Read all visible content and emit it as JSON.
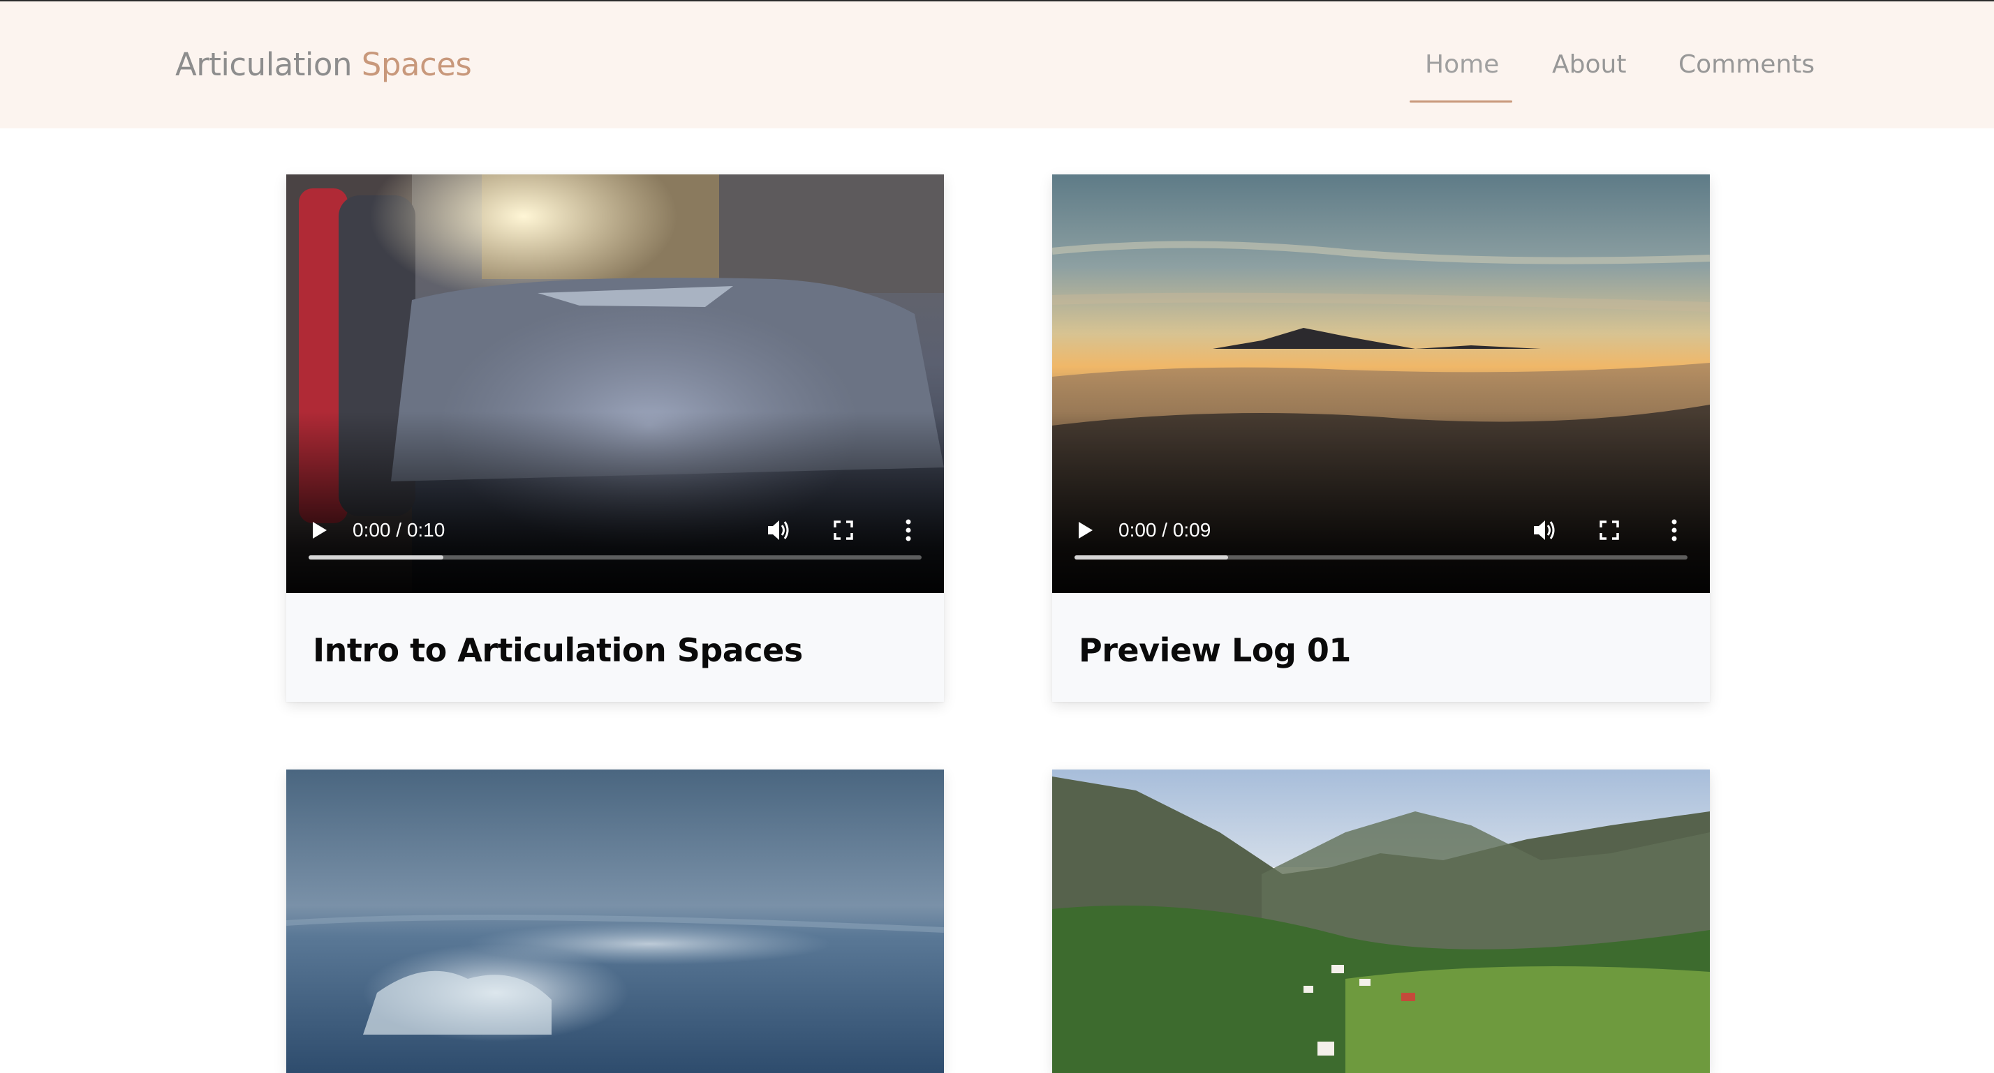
{
  "header": {
    "brand_part1": "Articulation",
    "brand_part2": "Spaces",
    "nav": [
      {
        "label": "Home",
        "active": true
      },
      {
        "label": "About",
        "active": false
      },
      {
        "label": "Comments",
        "active": false
      }
    ],
    "accent_color": "#c8987b",
    "background_color": "#fcf4ef"
  },
  "videos": [
    {
      "title": "Intro to Articulation Spaces",
      "time": "0:00 / 0:10",
      "buffered_fraction": 0.22
    },
    {
      "title": "Preview Log 01",
      "time": "0:00 / 0:09",
      "buffered_fraction": 0.25
    },
    {
      "title": "",
      "time": ""
    },
    {
      "title": "",
      "time": ""
    }
  ]
}
